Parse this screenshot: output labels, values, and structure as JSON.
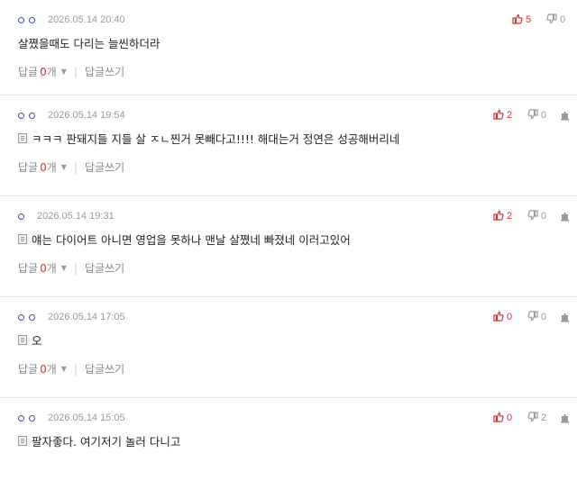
{
  "reply_label": "답글",
  "reply_unit": "개",
  "write_reply": "답글쓰기",
  "comments": [
    {
      "date": "2026.05.14 20:40",
      "up": "5",
      "down": "0",
      "text": "살쪘을때도 다리는 늘씬하더라",
      "reply_count": "0",
      "has_note": false,
      "show_report": false,
      "avatar_circles": 2
    },
    {
      "date": "2026.05.14 19:54",
      "up": "2",
      "down": "0",
      "text": "ㅋㅋㅋ 판돼지들 지들 살 ㅈㄴ찐거 못빼다고!!!! 해대는거 정연은 성공해버리네",
      "reply_count": "0",
      "has_note": true,
      "show_report": true,
      "avatar_circles": 2
    },
    {
      "date": "2026.05.14 19:31",
      "up": "2",
      "down": "0",
      "text": "얘는 다이어트 아니면 영업을 못하나 맨날 살쪘네 빠졌네 이러고있어",
      "reply_count": "0",
      "has_note": true,
      "show_report": true,
      "avatar_circles": 1
    },
    {
      "date": "2026.05.14 17:05",
      "up": "0",
      "down": "0",
      "text": "오",
      "reply_count": "0",
      "has_note": true,
      "show_report": true,
      "avatar_circles": 2
    },
    {
      "date": "2026.05.14 15:05",
      "up": "0",
      "down": "2",
      "text": "팔자좋다. 여기저기 놀러 다니고",
      "reply_count": "",
      "has_note": true,
      "show_report": true,
      "avatar_circles": 2
    }
  ],
  "colors": {
    "accent_red": "#d33333",
    "avatar_blue": "#3a4fa8",
    "meta_gray": "#9a9a9a"
  }
}
